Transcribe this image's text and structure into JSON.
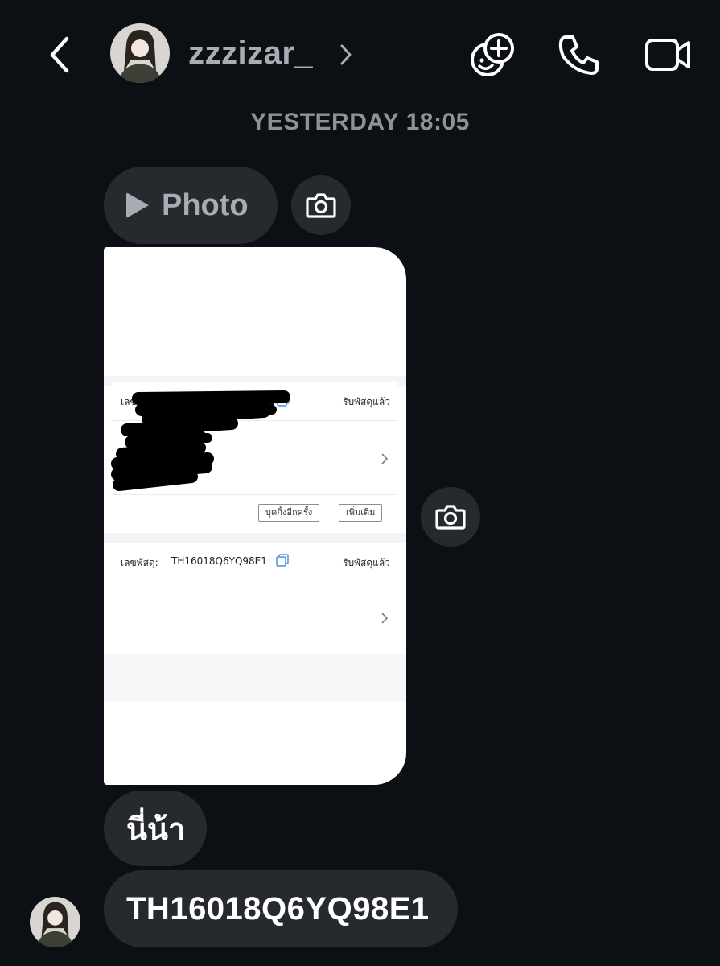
{
  "header": {
    "username": "zzzizar_",
    "icons": [
      "back-arrow-icon",
      "avatar",
      "chevron-right-icon",
      "effects-icon",
      "phone-icon",
      "video-call-icon"
    ]
  },
  "timestamp": "YESTERDAY 18:05",
  "messages": {
    "photo_label": "Photo",
    "text_1": "นี่น้า",
    "text_2": "TH16018Q6YQ98E1"
  },
  "screenshot": {
    "card1": {
      "parcel_label": "เลข",
      "status": "รับพัสดุแล้ว",
      "buttons": [
        "บุคกิ้งอีกครั้ง",
        "เพิ่มเติม"
      ]
    },
    "card2": {
      "parcel_label": "เลขพัสดุ:",
      "parcel_number": "TH16018Q6YQ98E1",
      "status": "รับพัสดุแล้ว"
    }
  },
  "colors": {
    "background": "#0c1014",
    "bubble": "#26292e",
    "muted_text": "#a8adb4",
    "copy_icon": "#4a90e2"
  }
}
